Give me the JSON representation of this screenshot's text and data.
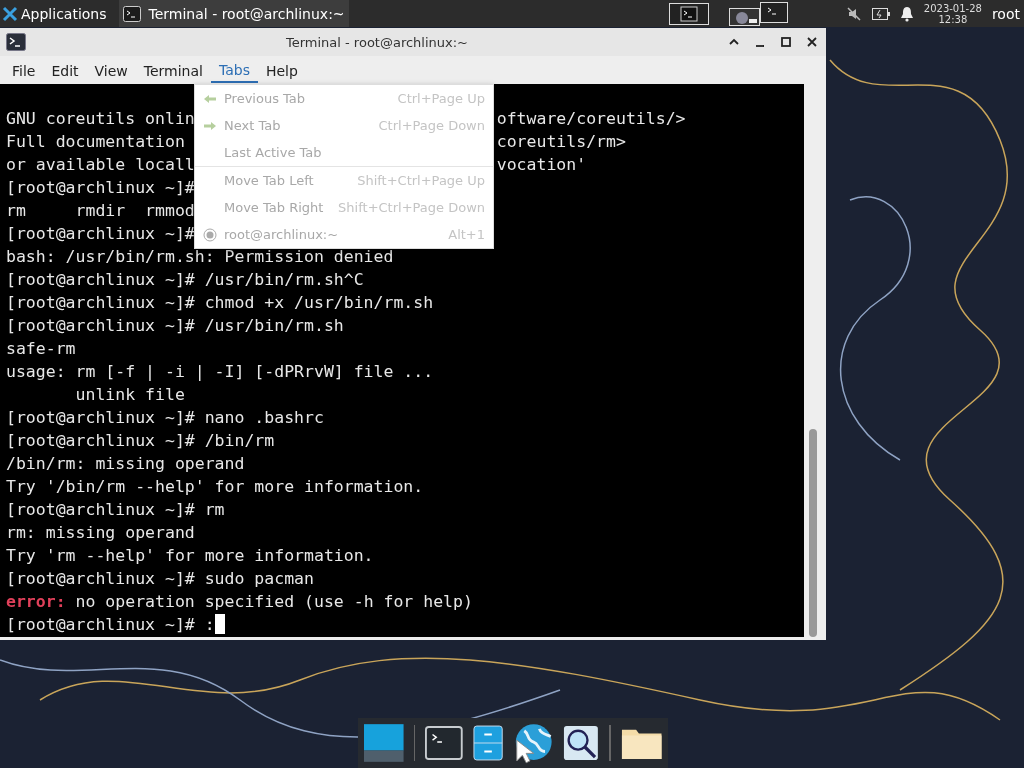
{
  "top_panel": {
    "applications_label": "Applications",
    "tasks": [
      {
        "label": "Terminal - root@archlinux:~",
        "selected": true
      }
    ],
    "clock": {
      "date": "2023-01-28",
      "time": "12:38"
    },
    "user": "root"
  },
  "window": {
    "title": "Terminal - root@archlinux:~"
  },
  "menubar": [
    {
      "label": "File",
      "selected": false
    },
    {
      "label": "Edit",
      "selected": false
    },
    {
      "label": "View",
      "selected": false
    },
    {
      "label": "Terminal",
      "selected": false
    },
    {
      "label": "Tabs",
      "selected": true
    },
    {
      "label": "Help",
      "selected": false
    }
  ],
  "tabs_menu": [
    {
      "kind": "back",
      "label": "Previous Tab",
      "shortcut": "Ctrl+Page Up",
      "disabled": true
    },
    {
      "kind": "forward",
      "label": "Next Tab",
      "shortcut": "Ctrl+Page Down",
      "disabled": true
    },
    {
      "kind": "plain",
      "label": "Last Active Tab",
      "disabled": true
    },
    {
      "kind": "separator"
    },
    {
      "kind": "plain",
      "label": "Move Tab Left",
      "shortcut": "Shift+Ctrl+Page Up",
      "disabled": true
    },
    {
      "kind": "plain",
      "label": "Move Tab Right",
      "shortcut": "Shift+Ctrl+Page Down",
      "disabled": true
    },
    {
      "kind": "radio",
      "label": "root@archlinux:~",
      "shortcut": "Alt+1",
      "selected": true,
      "disabled": true
    }
  ],
  "terminal_lines": [
    {
      "kind": "blank"
    },
    {
      "kind": "text",
      "text": "GNU coreutils onlin",
      "right": "oftware/coreutils/>"
    },
    {
      "kind": "text",
      "text": "Full documentation",
      "right": "coreutils/rm>"
    },
    {
      "kind": "text",
      "text": "or available locall",
      "right": "vocation'"
    },
    {
      "kind": "text",
      "text": "[root@archlinux ~]#"
    },
    {
      "kind": "text",
      "text": "rm     rmdir  rmmod"
    },
    {
      "kind": "text",
      "text": "[root@archlinux ~]#"
    },
    {
      "kind": "text",
      "text": "bash: /usr/bin/rm.sh: Permission denied"
    },
    {
      "kind": "text",
      "text": "[root@archlinux ~]# /usr/bin/rm.sh^C"
    },
    {
      "kind": "text",
      "text": "[root@archlinux ~]# chmod +x /usr/bin/rm.sh"
    },
    {
      "kind": "text",
      "text": "[root@archlinux ~]# /usr/bin/rm.sh"
    },
    {
      "kind": "text",
      "text": "safe-rm"
    },
    {
      "kind": "text",
      "text": "usage: rm [-f | -i | -I] [-dPRrvW] file ..."
    },
    {
      "kind": "text",
      "text": "       unlink file"
    },
    {
      "kind": "text",
      "text": "[root@archlinux ~]# nano .bashrc"
    },
    {
      "kind": "text",
      "text": "[root@archlinux ~]# /bin/rm"
    },
    {
      "kind": "text",
      "text": "/bin/rm: missing operand"
    },
    {
      "kind": "text",
      "text": "Try '/bin/rm --help' for more information."
    },
    {
      "kind": "text",
      "text": "[root@archlinux ~]# rm"
    },
    {
      "kind": "text",
      "text": "rm: missing operand"
    },
    {
      "kind": "text",
      "text": "Try 'rm --help' for more information."
    },
    {
      "kind": "text",
      "text": "[root@archlinux ~]# sudo pacman"
    },
    {
      "kind": "error",
      "label": "error:",
      "text": "no operation specified (use -h for help)"
    },
    {
      "kind": "prompt",
      "text": "[root@archlinux ~]# :"
    }
  ]
}
